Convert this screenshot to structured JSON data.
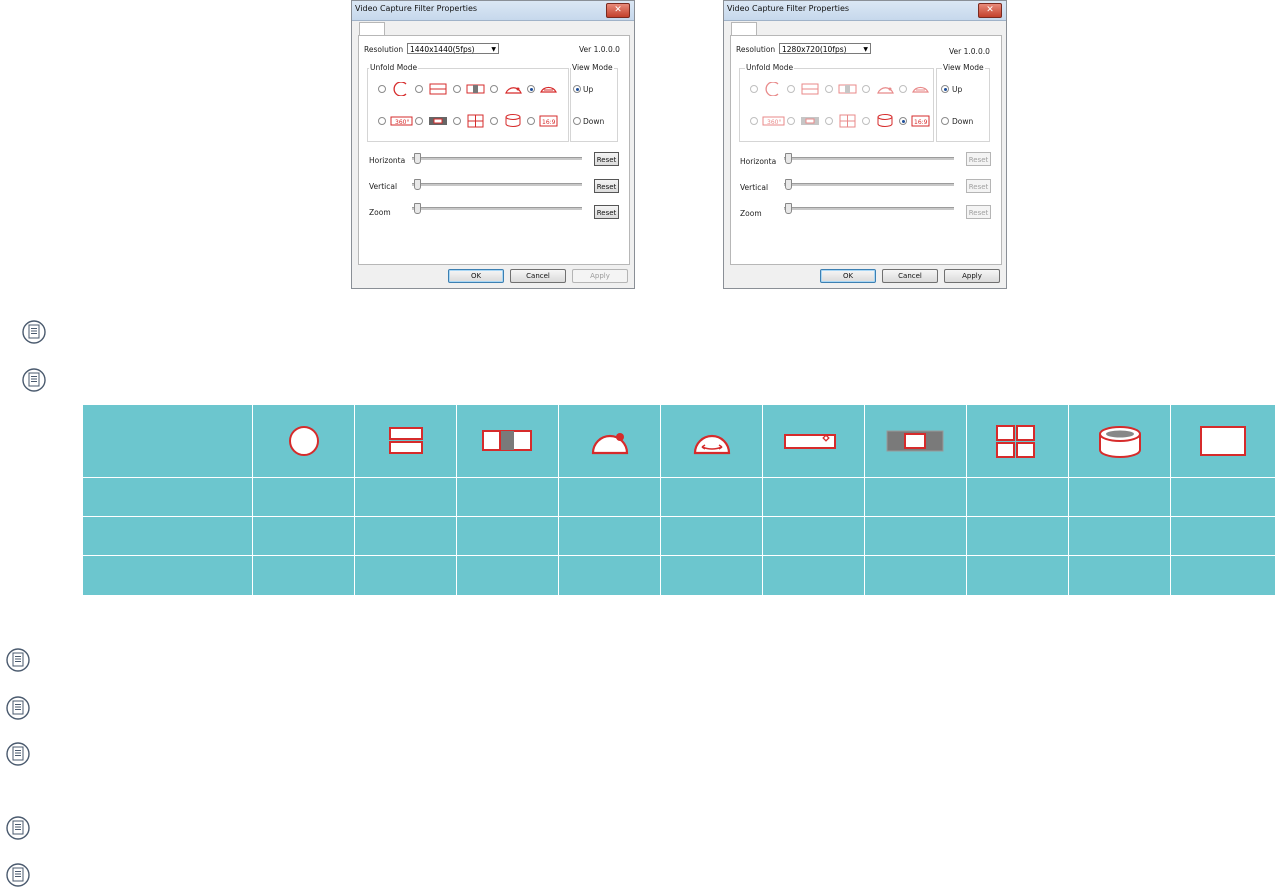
{
  "dialog_left": {
    "title": "Video Capture Filter Properties",
    "resolution_label": "Resolution",
    "resolution_value": "1440x1440(5fps)",
    "version": "Ver 1.0.0.0",
    "unfold_mode_label": "Unfold Mode",
    "view_mode_label": "View Mode",
    "view_up": "Up",
    "view_down": "Down",
    "mode_360_label": "360°",
    "mode_169_label": "16:9",
    "horizontal_label": "Horizonta",
    "vertical_label": "Vertical",
    "zoom_label": "Zoom",
    "reset_label": "Reset",
    "ok_label": "OK",
    "cancel_label": "Cancel",
    "apply_label": "Apply"
  },
  "dialog_right": {
    "title": "Video Capture Filter Properties",
    "resolution_label": "Resolution",
    "resolution_value": "1280x720(10fps)",
    "version": "Ver 1.0.0.0",
    "unfold_mode_label": "Unfold Mode",
    "view_mode_label": "View Mode",
    "view_up": "Up",
    "view_down": "Down",
    "mode_360_label": "360°",
    "mode_169_label": "16:9",
    "horizontal_label": "Horizonta",
    "vertical_label": "Vertical",
    "zoom_label": "Zoom",
    "reset_label": "Reset",
    "ok_label": "OK",
    "cancel_label": "Cancel",
    "apply_label": "Apply"
  },
  "colors": {
    "mode_icon_red": "#d62b2b",
    "table_teal": "#6cc6ce",
    "note_icon": "#4a5a6e"
  },
  "icons": [
    "note-icon",
    "close-icon",
    "fisheye-icon",
    "panorama-2-icon",
    "ptz-icon",
    "dome-up-icon",
    "dome-pan-icon",
    "wide-icon",
    "center-crop-icon",
    "quad-icon",
    "cylinder-icon",
    "rectangle-icon"
  ]
}
